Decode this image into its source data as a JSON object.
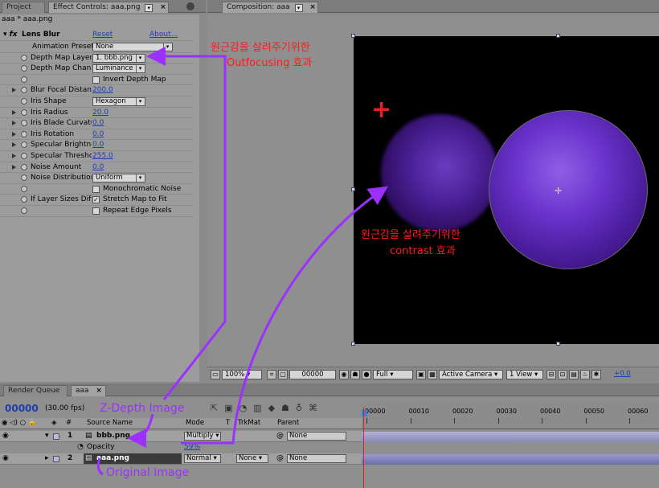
{
  "tabs": {
    "project": "Project",
    "effect_controls": "Effect Controls: aaa.png",
    "composition": "Composition: aaa",
    "render_queue": "Render Queue",
    "timeline_tab": "aaa"
  },
  "effect_controls": {
    "breadcrumb": "aaa * aaa.png",
    "effect_name": "Lens Blur",
    "reset": "Reset",
    "about": "About...",
    "rows": [
      {
        "label": "Animation Presets:",
        "kind": "select",
        "value": "None"
      },
      {
        "label": "Depth Map Layer",
        "kind": "select",
        "value": "1. bbb.png"
      },
      {
        "label": "Depth Map Channel",
        "kind": "select",
        "value": "Luminance"
      },
      {
        "label": "",
        "kind": "check",
        "value": "Invert Depth Map",
        "checked": false
      },
      {
        "label": "Blur Focal Distance",
        "kind": "num",
        "value": "200.0"
      },
      {
        "label": "Iris Shape",
        "kind": "select",
        "value": "Hexagon"
      },
      {
        "label": "Iris Radius",
        "kind": "num",
        "value": "20.0"
      },
      {
        "label": "Iris Blade Curvatur",
        "kind": "num",
        "value": "0.0"
      },
      {
        "label": "Iris Rotation",
        "kind": "num",
        "value": "0.0"
      },
      {
        "label": "Specular Brightnes",
        "kind": "num",
        "value": "0.0"
      },
      {
        "label": "Specular Threshold",
        "kind": "num",
        "value": "255.0"
      },
      {
        "label": "Noise Amount",
        "kind": "num",
        "value": "0.0"
      },
      {
        "label": "Noise Distribution",
        "kind": "select",
        "value": "Uniform"
      },
      {
        "label": "",
        "kind": "check",
        "value": "Monochromatic Noise",
        "checked": false
      },
      {
        "label": "If Layer Sizes Diffe",
        "kind": "check",
        "value": "Stretch Map to Fit",
        "checked": true
      },
      {
        "label": "",
        "kind": "check",
        "value": "Repeat Edge Pixels",
        "checked": false
      }
    ]
  },
  "viewer": {
    "zoom": "100%",
    "timecode": "00000",
    "resolution": "Full",
    "camera": "Active Camera",
    "view": "1 View",
    "exposure": "+0.0"
  },
  "timeline": {
    "current_time": "00000",
    "fps": "(30.00 fps)",
    "columns": {
      "num": "#",
      "source": "Source Name",
      "mode": "Mode",
      "t": "T",
      "trkmat": "TrkMat",
      "parent": "Parent"
    },
    "layers": [
      {
        "num": "1",
        "name": "bbb.png",
        "mode": "Multiply",
        "trkmat": "",
        "parent": "None"
      },
      {
        "num": "2",
        "name": "aaa.png",
        "mode": "Normal",
        "trkmat": "None",
        "parent": "None"
      }
    ],
    "opacity_label": "Opacity",
    "opacity_value": "59%",
    "ruler": [
      "00000",
      "00010",
      "00020",
      "00030",
      "00040",
      "00050",
      "00060"
    ]
  },
  "annotations": {
    "outfocus_kr": "원근감을 살려주기위한",
    "outfocus_en": "Outfocusing 효과",
    "contrast_kr": "원근감을 살려주기위한",
    "contrast_en": "contrast 효과",
    "zdepth": "Z-Depth Image",
    "original": "Original Image"
  },
  "colors": {
    "annotation_red": "#ff1a1a",
    "annotation_purple": "#9b30ff",
    "sphere_purple": "#5a22b0",
    "timecode_blue": "#1a3fb0"
  }
}
